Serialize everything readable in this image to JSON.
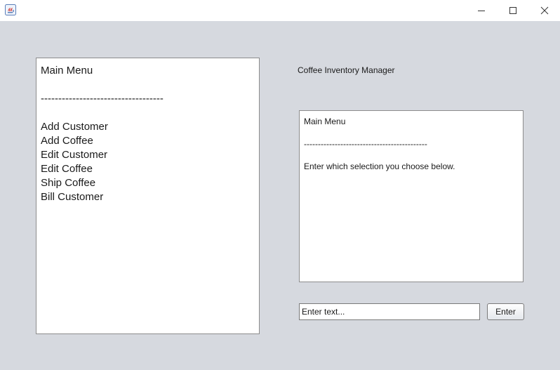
{
  "window": {
    "app_icon": "java-icon",
    "controls": [
      "minimize-icon",
      "maximize-icon",
      "close-icon"
    ]
  },
  "left_panel": {
    "lines": [
      "Main Menu",
      "",
      "-----------------------------------",
      "",
      "Add Customer",
      "Add Coffee",
      "Edit Customer",
      "Edit Coffee",
      "Ship Coffee",
      "Bill Customer"
    ]
  },
  "header": {
    "title": "Coffee Inventory Manager"
  },
  "output_panel": {
    "lines": [
      "Main Menu",
      "",
      "--------------------------------------------",
      "",
      "Enter which selection you choose below."
    ]
  },
  "input": {
    "value": "Enter text..."
  },
  "buttons": {
    "enter_label": "Enter"
  }
}
